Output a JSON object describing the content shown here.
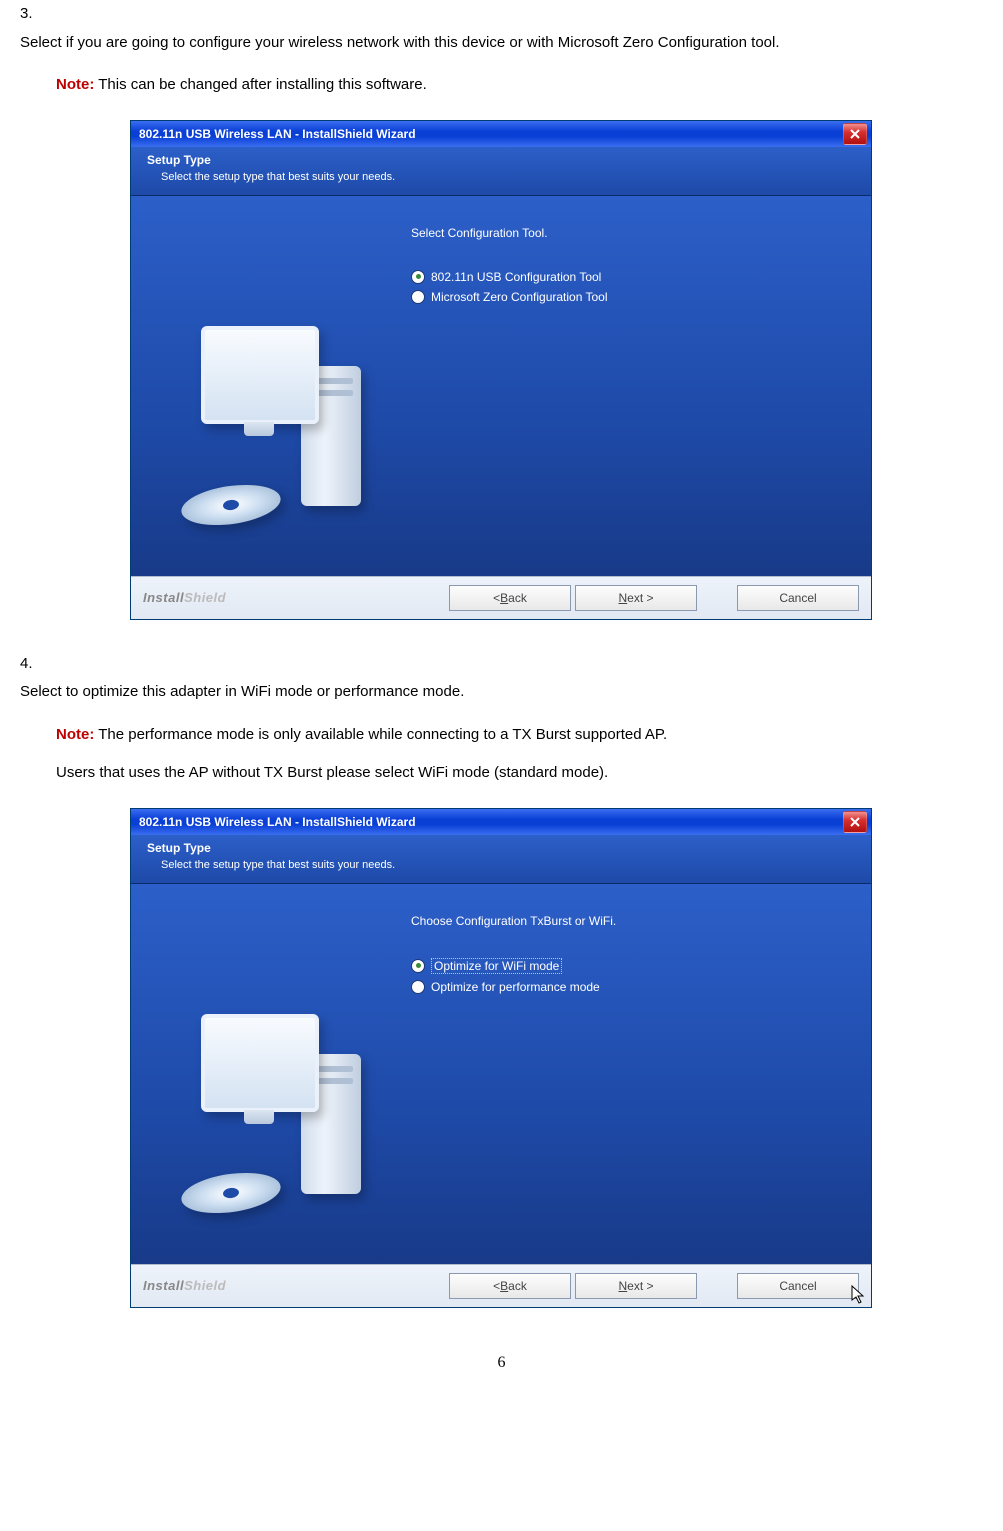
{
  "steps": {
    "s3": {
      "num": "3.",
      "text": "Select if you are going to configure your wireless network with this device or with Microsoft Zero Configuration tool."
    },
    "s4": {
      "num": "4.",
      "text": "Select to optimize this adapter in WiFi mode or performance mode."
    }
  },
  "notes": {
    "label": "Note:",
    "n3": "This can be changed after installing this software.",
    "n4a": "The performance mode is only available while connecting to a TX Burst supported AP.",
    "n4b": "Users that uses the AP without TX Burst please select WiFi mode (standard mode)."
  },
  "wizard": {
    "title": "802.11n USB Wireless LAN - InstallShield Wizard",
    "setup_type": "Setup Type",
    "setup_desc": "Select the setup type that best suits your needs.",
    "brand1": "Install",
    "brand2": "Shield",
    "back": "< Back",
    "next": "Next >",
    "cancel": "Cancel",
    "back_u": "B",
    "next_u": "N"
  },
  "dlg1": {
    "prompt": "Select Configuration Tool.",
    "opt1": "802.11n USB Configuration Tool",
    "opt2": "Microsoft Zero Configuration Tool"
  },
  "dlg2": {
    "prompt": "Choose Configuration TxBurst or WiFi.",
    "opt1": "Optimize for WiFi mode",
    "opt2": "Optimize for performance mode"
  },
  "pagenum": "6"
}
